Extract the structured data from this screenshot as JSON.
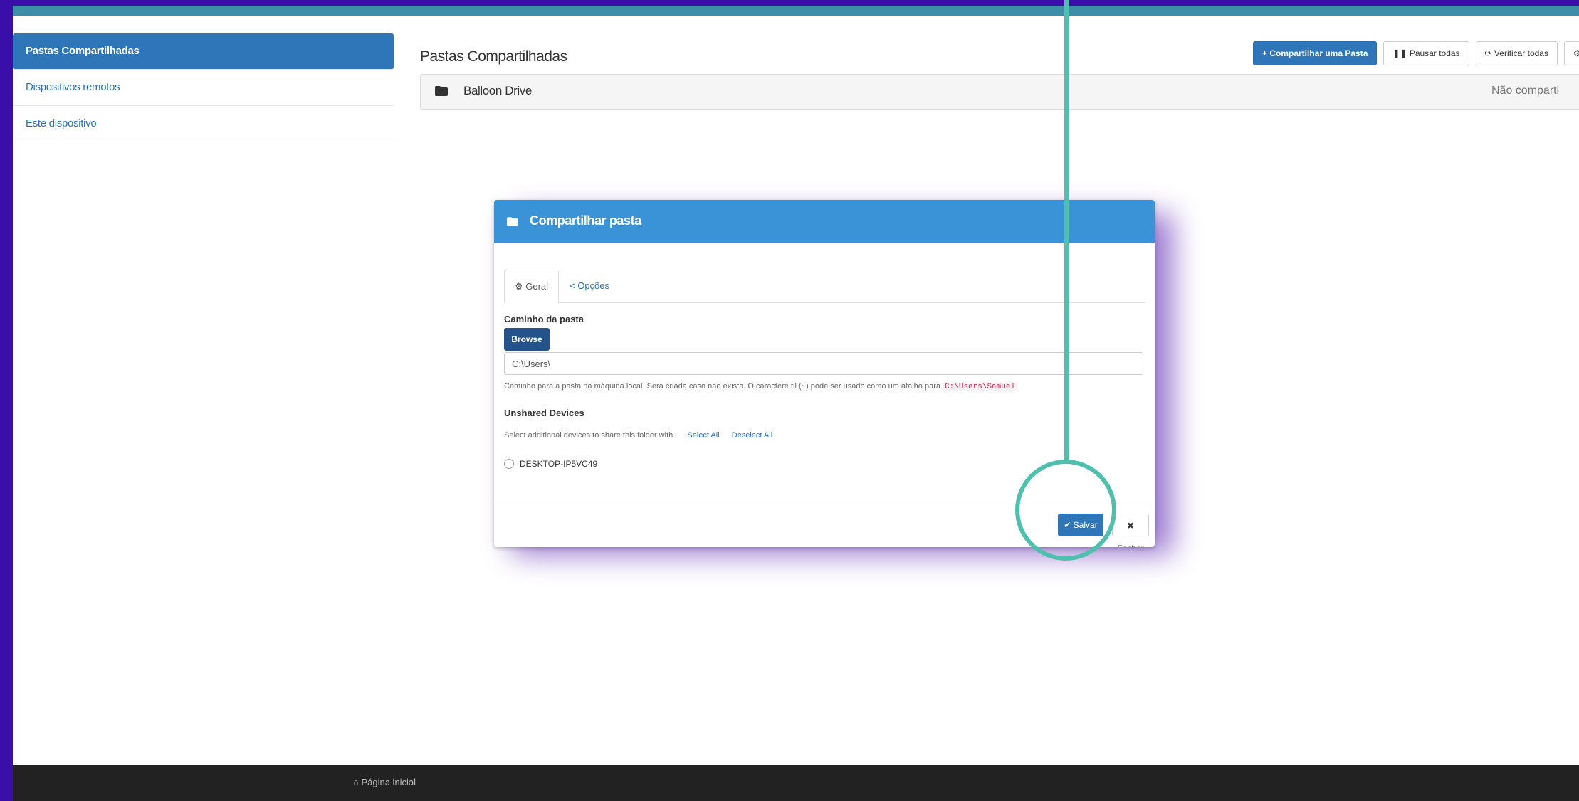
{
  "sidebar": {
    "items": [
      {
        "label": "Pastas Compartilhadas",
        "active": true
      },
      {
        "label": "Dispositivos remotos",
        "active": false
      },
      {
        "label": "Este dispositivo",
        "active": false
      }
    ]
  },
  "main": {
    "title": "Pastas Compartilhadas",
    "folders": [
      {
        "name": "Balloon Drive",
        "status": "Não comparti"
      }
    ]
  },
  "toolbar": {
    "share_label": "+ Compartilhar uma Pasta",
    "pause_label": "❚❚ Pausar todas",
    "verify_label": "⟳ Verificar todas",
    "more_label": "⚙ Re"
  },
  "modal": {
    "title": "Compartilhar pasta",
    "tab_general": "⚙ Geral",
    "tab_options": "< Opções",
    "path_label": "Caminho da pasta",
    "browse_label": "Browse",
    "path_value": "C:\\Users\\",
    "path_help": "Caminho para a pasta na máquina local. Será criada caso não exista. O caractere til (~) pode ser usado como um atalho para",
    "path_help_code": "C:\\Users\\Samuel",
    "unshared_label": "Unshared Devices",
    "select_help": "Select additional devices to share this folder with.",
    "select_all": "Select All",
    "deselect_all": "Deselect All",
    "device_name": "DESKTOP-IP5VC49",
    "save_label": "✔ Salvar",
    "close_label": "✖ Fechar"
  },
  "footer": {
    "home_label": "⌂ Página inicial"
  },
  "colors": {
    "primary": "#2f76b9",
    "header": "#3a93d6",
    "annotation": "#4fbfae",
    "background": "#3a0ea8"
  }
}
